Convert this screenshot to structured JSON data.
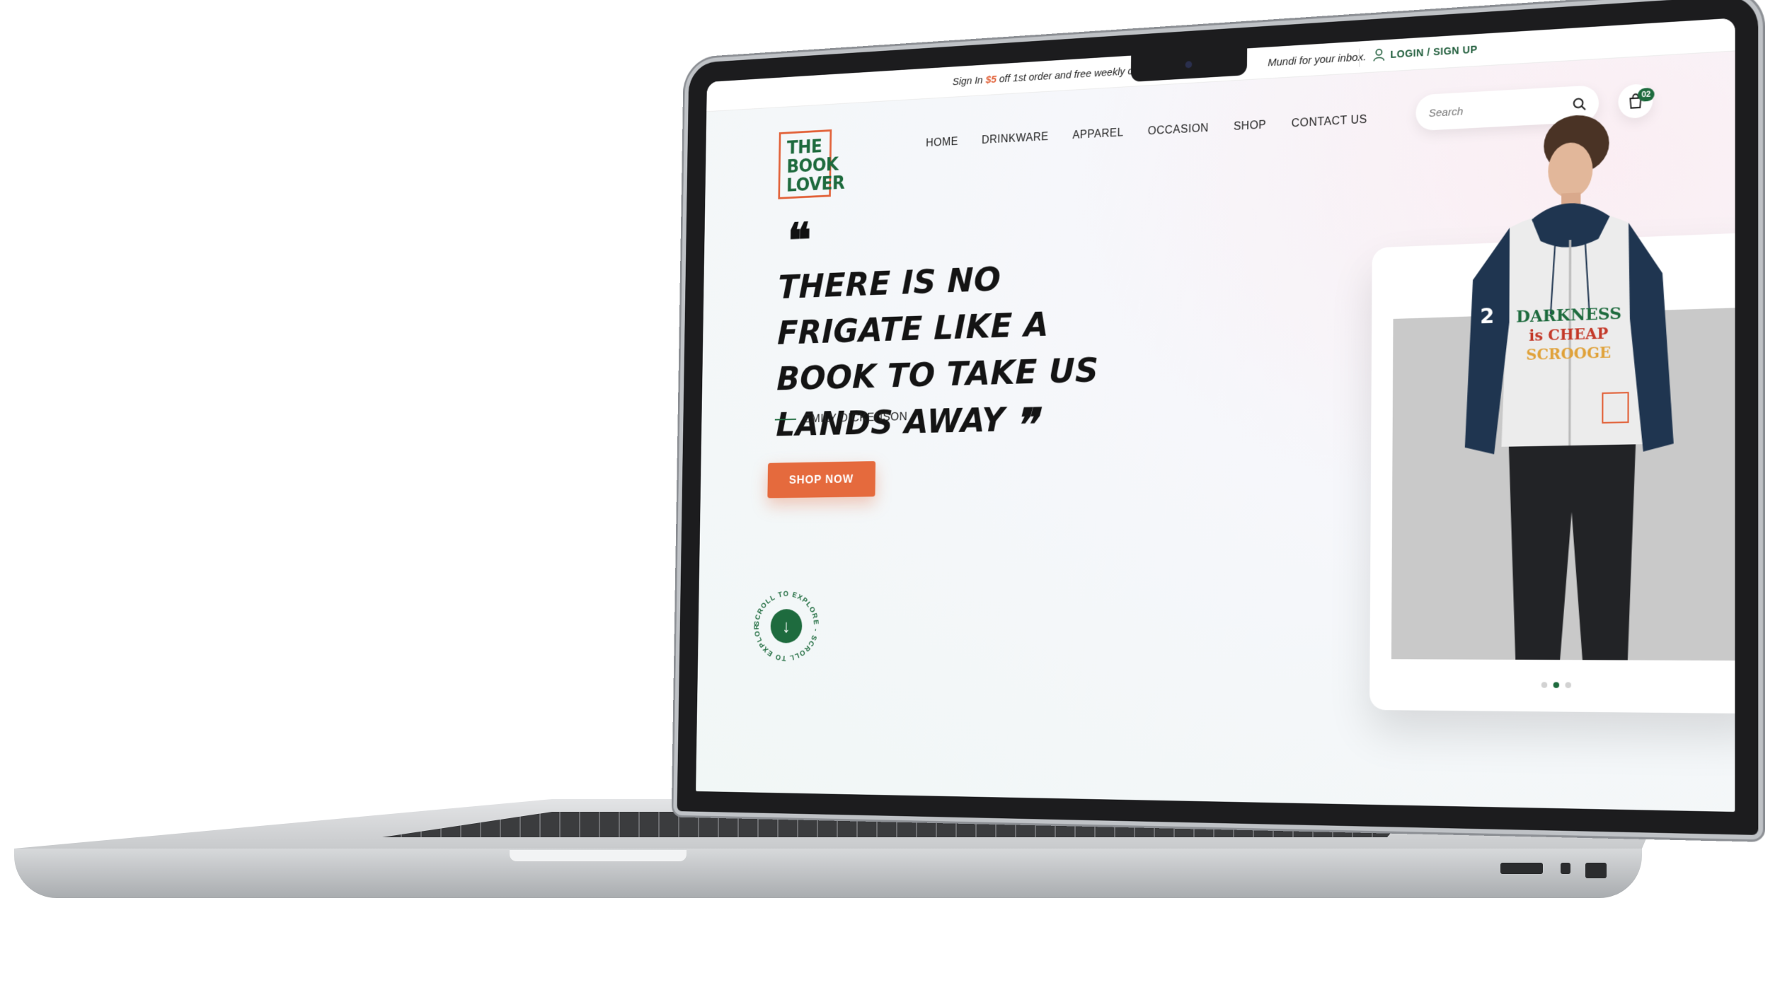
{
  "topbar": {
    "promo_prefix": "Sign In",
    "promo_amount": "$5",
    "promo_middle": "off 1st order and free weekly classic",
    "promo_tail": "Mundi for your inbox.",
    "login_label": "LOGIN / SIGN UP"
  },
  "brand": {
    "logo_line1": "THE",
    "logo_line2": "BOOK",
    "logo_line3": "LOVER"
  },
  "nav": {
    "items": [
      {
        "label": "HOME"
      },
      {
        "label": "DRINKWARE"
      },
      {
        "label": "APPAREL"
      },
      {
        "label": "OCCASION"
      },
      {
        "label": "SHOP"
      },
      {
        "label": "CONTACT US"
      }
    ]
  },
  "search": {
    "placeholder": "Search"
  },
  "cart": {
    "count": "02"
  },
  "hero": {
    "quote": "THERE IS NO FRIGATE LIKE A BOOK TO TAKE US LANDS AWAY",
    "author": "EMILY DICKENSON",
    "cta_label": "SHOP NOW",
    "scroll_text": "SCROLL TO EXPLORE - SCROLL TO EXPLORE - ",
    "scroll_arrow": "↓"
  },
  "product": {
    "shirt_line1": "DARKNESS",
    "shirt_line2": "is CHEAP",
    "shirt_line3": "SCROOGE",
    "sleeve_number": "2",
    "carousel_active": 2,
    "carousel_total": 3
  },
  "colors": {
    "brand_green": "#1e6b3e",
    "accent_orange": "#e56a3d",
    "text_dark": "#141414"
  },
  "icons": {
    "search": "search-icon",
    "cart": "shopping-bag-icon",
    "user": "user-icon",
    "scroll": "arrow-down-icon"
  }
}
